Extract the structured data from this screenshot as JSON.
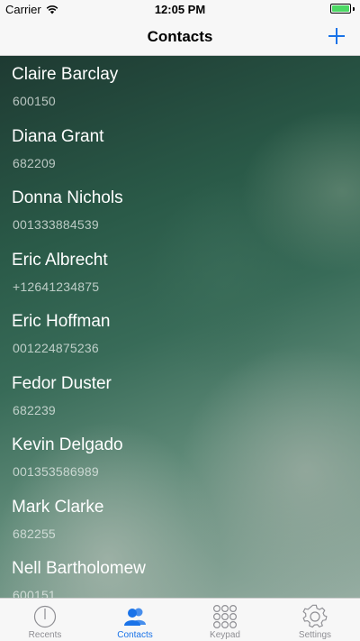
{
  "status_bar": {
    "carrier": "Carrier",
    "time": "12:05 PM",
    "wifi_icon": "wifi-icon",
    "battery_icon": "battery-charging-icon",
    "battery_level": 1.0,
    "battery_color": "#4cd964"
  },
  "nav": {
    "title": "Contacts",
    "add_icon": "plus-icon",
    "accent_color": "#1a73e8"
  },
  "contacts": [
    {
      "name": "Claire Barclay",
      "number": "600150"
    },
    {
      "name": "Diana Grant",
      "number": "682209"
    },
    {
      "name": "Donna Nichols",
      "number": "001333884539"
    },
    {
      "name": "Eric Albrecht",
      "number": "+12641234875"
    },
    {
      "name": "Eric Hoffman",
      "number": "001224875236"
    },
    {
      "name": "Fedor Duster",
      "number": "682239"
    },
    {
      "name": "Kevin Delgado",
      "number": "001353586989"
    },
    {
      "name": "Mark Clarke",
      "number": "682255"
    },
    {
      "name": "Nell Bartholomew",
      "number": "600151"
    }
  ],
  "tabs": [
    {
      "label": "Recents",
      "icon": "clock-icon",
      "active": false
    },
    {
      "label": "Contacts",
      "icon": "people-icon",
      "active": true
    },
    {
      "label": "Keypad",
      "icon": "keypad-icon",
      "active": false
    },
    {
      "label": "Settings",
      "icon": "gear-icon",
      "active": false
    }
  ]
}
